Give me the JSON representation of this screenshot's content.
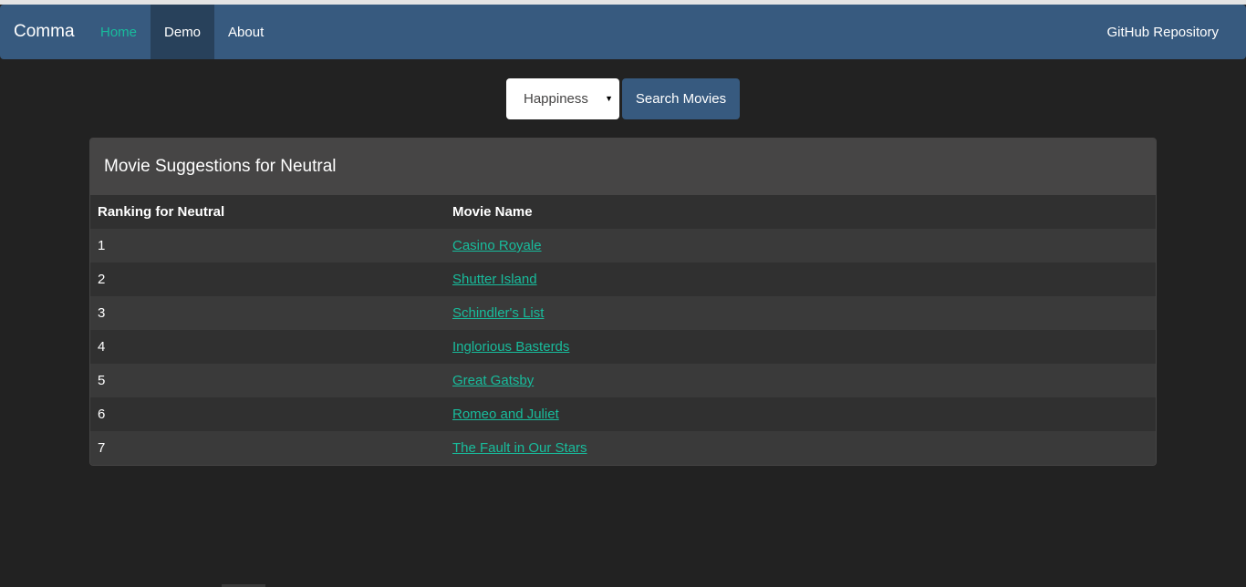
{
  "navbar": {
    "brand": "Comma",
    "items": [
      {
        "label": "Home"
      },
      {
        "label": "Demo"
      },
      {
        "label": "About"
      }
    ],
    "right_link": "GitHub Repository"
  },
  "search": {
    "selected_option": "Happiness",
    "button_label": "Search Movies"
  },
  "panel": {
    "title": "Movie Suggestions for Neutral",
    "columns": [
      "Ranking for Neutral",
      "Movie Name"
    ],
    "rows": [
      {
        "rank": "1",
        "movie": "Casino Royale"
      },
      {
        "rank": "2",
        "movie": "Shutter Island"
      },
      {
        "rank": "3",
        "movie": "Schindler's List"
      },
      {
        "rank": "4",
        "movie": "Inglorious Basterds"
      },
      {
        "rank": "5",
        "movie": "Great Gatsby"
      },
      {
        "rank": "6",
        "movie": "Romeo and Juliet"
      },
      {
        "rank": "7",
        "movie": "The Fault in Our Stars"
      }
    ]
  },
  "colors": {
    "navbar": "#375a7f",
    "accent": "#18bc9c",
    "background": "#222222"
  }
}
